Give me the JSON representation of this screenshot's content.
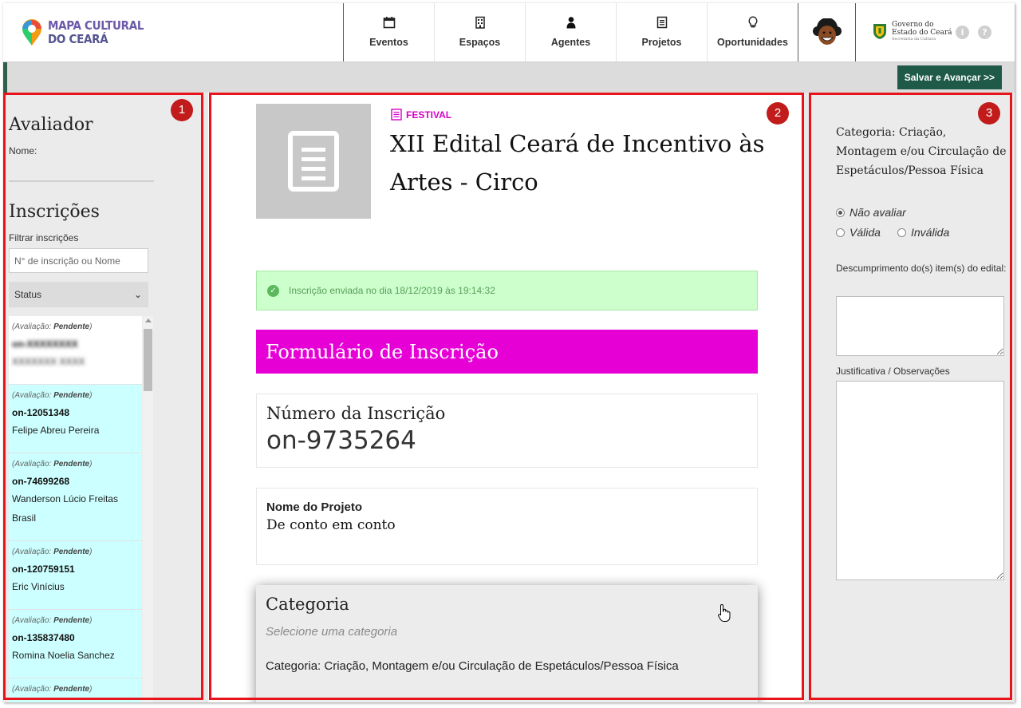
{
  "header": {
    "logo_line1": "MAPA CULTURAL",
    "logo_line2": "DO CEARÁ",
    "nav": [
      {
        "label": "Eventos",
        "icon": "calendar-icon"
      },
      {
        "label": "Espaços",
        "icon": "building-icon"
      },
      {
        "label": "Agentes",
        "icon": "person-icon"
      },
      {
        "label": "Projetos",
        "icon": "document-icon"
      },
      {
        "label": "Oportunidades",
        "icon": "lightbulb-icon"
      }
    ],
    "gov_line1": "Governo do",
    "gov_line2": "Estado do Ceará",
    "gov_line3": "Secretaria da Cultura",
    "info_icon": "i",
    "help_icon": "?"
  },
  "actionbar": {
    "save_label": "Salvar e Avançar >>"
  },
  "annotations": {
    "badge1": "1",
    "badge2": "2",
    "badge3": "3"
  },
  "left": {
    "evaluator_title": "Avaliador",
    "name_label": "Nome:",
    "inscriptions_title": "Inscrições",
    "filter_label": "Filtrar inscrições",
    "search_placeholder": "N° de inscrição ou Nome",
    "status_label": "Status",
    "eval_prefix": "(Avaliação:",
    "eval_status": "Pendente",
    "eval_suffix": ")",
    "entries": [
      {
        "number": "on-XXXXXXXX",
        "name": "XXXXXXX XXXX",
        "style": "white",
        "blurred": true
      },
      {
        "number": "on-12051348",
        "name": "Felipe Abreu Pereira",
        "style": "cyan"
      },
      {
        "number": "on-74699268",
        "name": "Wanderson Lúcio Freitas Brasil",
        "style": "cyan"
      },
      {
        "number": "on-120759151",
        "name": "Eric Vinícius",
        "style": "cyan"
      },
      {
        "number": "on-135837480",
        "name": "Romina Noelia Sanchez",
        "style": "cyan"
      },
      {
        "number": "",
        "name": "",
        "style": "cyan"
      }
    ]
  },
  "middle": {
    "type": "FESTIVAL",
    "title": "XII Edital Ceará de Incentivo às Artes - Circo",
    "success_message": "Inscrição enviada no dia 18/12/2019 às 19:14:32",
    "form_title": "Formulário de Inscrição",
    "registration_label": "Número da Inscrição",
    "registration_number": "on-9735264",
    "project_label": "Nome do Projeto",
    "project_name": "De conto em conto",
    "category_label": "Categoria",
    "category_hint": "Selecione uma categoria",
    "category_option": "Categoria: Criação, Montagem e/ou Circulação de Espetáculos/Pessoa Física"
  },
  "right": {
    "category": "Categoria: Criação, Montagem e/ou Circulação de Espetáculos/Pessoa Física",
    "radio_no_eval": "Não avaliar",
    "radio_valid": "Válida",
    "radio_invalid": "Inválida",
    "breach_label": "Descumprimento do(s) item(s) do edital:",
    "justification_label": "Justificativa / Observações"
  },
  "colors": {
    "accent_green": "#1f5a48",
    "magenta": "#e600d6",
    "annotation_red": "#e8141b",
    "success_bg": "#ccffcc",
    "cyan_row": "#ccffff"
  }
}
